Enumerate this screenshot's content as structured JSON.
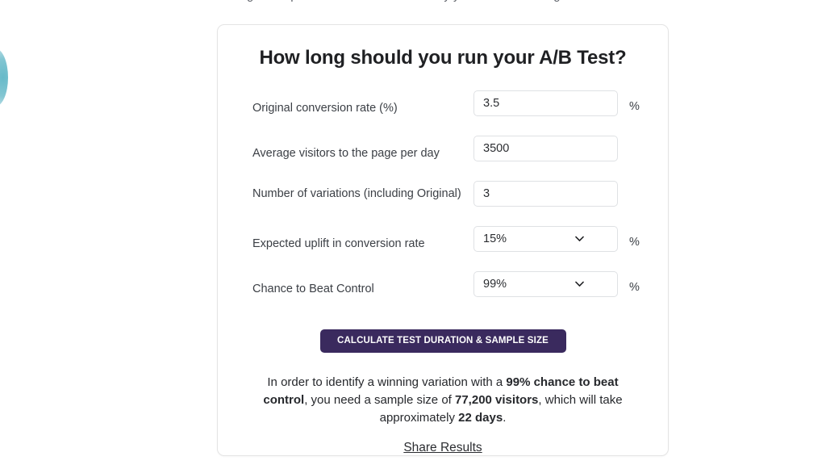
{
  "page": {
    "background_color": "#ffffff",
    "clipped_top_text": "tags and questions. Look around. Study your data. Make a guess.",
    "decoration": {
      "name": "teal-blob",
      "color": "#7cc3d0"
    }
  },
  "card": {
    "title": "How long should you run your A/B Test?",
    "border_color": "#e4e4e4",
    "fields": [
      {
        "id": "original-conversion-rate",
        "label": "Original conversion rate (%)",
        "type": "text",
        "value": "3.5",
        "placeholder": "",
        "suffix": "%"
      },
      {
        "id": "average-visitors-per-day",
        "label": "Average visitors to the page per day",
        "type": "text",
        "value": "3500",
        "placeholder": "",
        "suffix": ""
      },
      {
        "id": "number-of-variations",
        "label": "Number of variations (including Original)",
        "type": "text",
        "value": "3",
        "placeholder": "",
        "suffix": ""
      },
      {
        "id": "expected-uplift",
        "label": "Expected uplift in conversion rate",
        "type": "select",
        "value": "15%",
        "suffix": "%",
        "icon": "chevron-down-icon"
      },
      {
        "id": "chance-to-beat-control",
        "label": "Chance to Beat Control",
        "type": "select",
        "value": "99%",
        "suffix": "%",
        "icon": "chevron-down-icon"
      }
    ],
    "cta": {
      "label": "CALCULATE TEST DURATION & SAMPLE SIZE",
      "color": "#3a2a5e",
      "text_color": "#ffffff"
    },
    "result": {
      "part1": "In order to identify a winning variation with a ",
      "bold1": "99% chance to beat control",
      "part2": ", you need a sample size of ",
      "bold2": "77,200 visitors",
      "part3": ", which will take approximately ",
      "bold3": "22 days",
      "part4": "."
    },
    "share": {
      "label": "Share Results"
    }
  }
}
